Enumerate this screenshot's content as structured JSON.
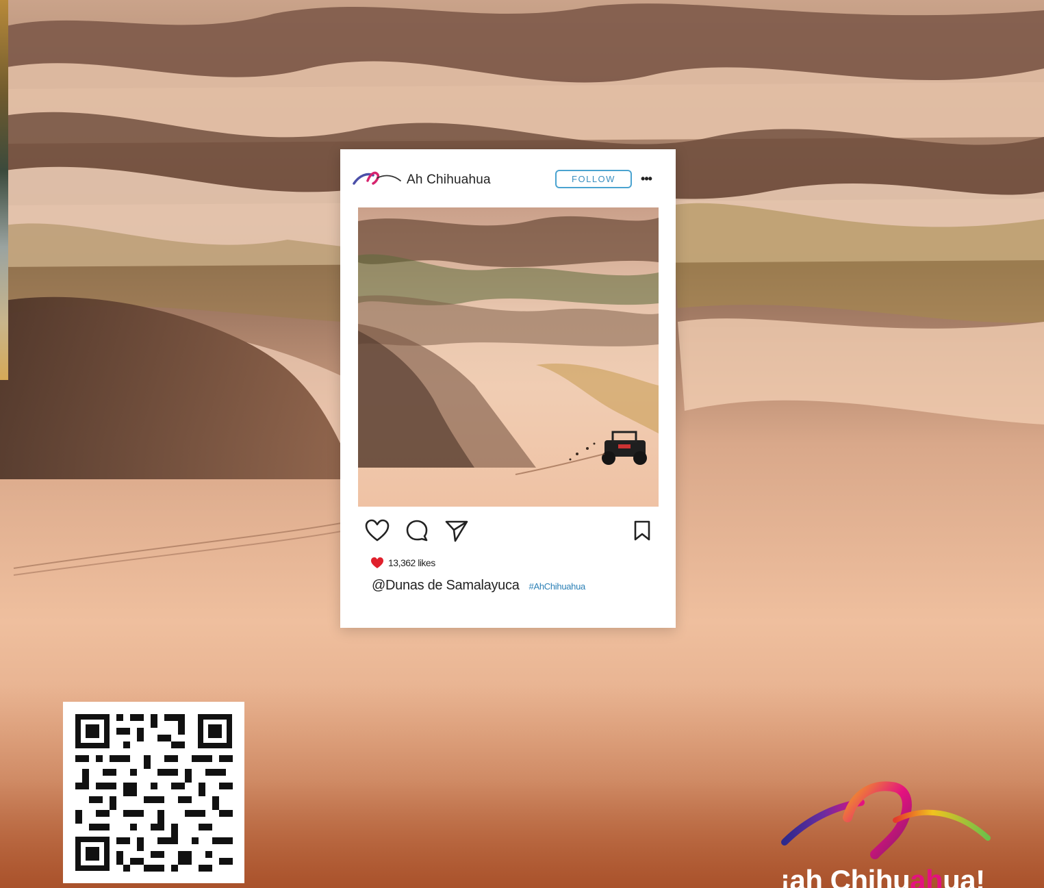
{
  "post": {
    "account_name": "Ah Chihuahua",
    "follow_label": "FOLLOW",
    "more_label": "•••",
    "likes_text": "13,362 likes",
    "caption_handle": "@Dunas de Samalayuca",
    "caption_hashtag": "#AhChihuahua"
  },
  "icons": {
    "like": "heart-icon",
    "comment": "comment-icon",
    "share": "send-icon",
    "save": "bookmark-icon",
    "liked": "filled-heart-icon",
    "brand": "ah-chihuahua-logo"
  },
  "brand_logo": {
    "text_prefix": "¡ah Chihu",
    "text_highlight": "ah",
    "text_suffix": "ua!"
  },
  "colors": {
    "follow_blue": "#3a8fc0",
    "hashtag_blue": "#2a7fb5",
    "heart_red": "#e0202c",
    "brand_magenta": "#e4127f",
    "sand": "#e8b794"
  }
}
